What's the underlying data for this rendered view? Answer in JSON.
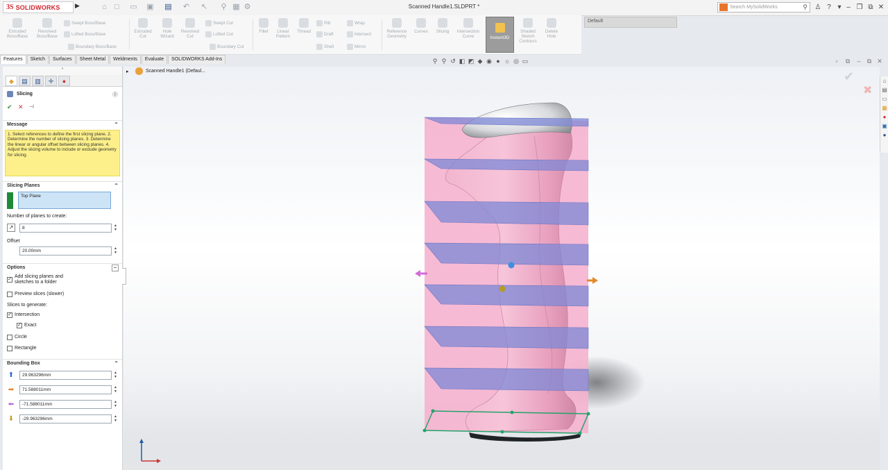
{
  "app": {
    "logo_mark": "3S",
    "logo_text": "SOLIDWORKS",
    "document_title": "Scanned Handle1.SLDPRT *",
    "search_placeholder": "Search MySolidWorks",
    "config_value": "Default"
  },
  "quick_access": [
    "home-icon",
    "new-icon",
    "open-icon",
    "save-icon",
    "print-icon",
    "undo-icon",
    "select-icon",
    "rebuild-icon",
    "file-properties-icon",
    "options-icon"
  ],
  "command_manager": {
    "large": [
      {
        "label": "Extruded Boss/Base",
        "icon": "extrude-boss-icon"
      },
      {
        "label": "Revolved Boss/Base",
        "icon": "revolve-boss-icon"
      },
      {
        "label": "Extruded Cut",
        "icon": "extrude-cut-icon"
      },
      {
        "label": "Hole Wizard",
        "icon": "hole-wizard-icon"
      },
      {
        "label": "Revolved Cut",
        "icon": "revolve-cut-icon"
      },
      {
        "label": "Fillet",
        "icon": "fillet-icon"
      },
      {
        "label": "Linear Pattern",
        "icon": "linear-pattern-icon"
      },
      {
        "label": "Thread",
        "icon": "thread-icon"
      },
      {
        "label": "Reference Geometry",
        "icon": "reference-geometry-icon"
      },
      {
        "label": "Curves",
        "icon": "curves-icon"
      },
      {
        "label": "Slicing",
        "icon": "slicing-icon"
      },
      {
        "label": "Intersection Curve",
        "icon": "intersection-curve-icon"
      },
      {
        "label": "Instant3D",
        "icon": "instant3d-icon"
      },
      {
        "label": "Shaded Sketch Contours",
        "icon": "shaded-sketch-icon"
      },
      {
        "label": "Delete Hole",
        "icon": "delete-hole-icon"
      }
    ],
    "small": [
      {
        "label": "Swept Boss/Base"
      },
      {
        "label": "Lofted Boss/Base"
      },
      {
        "label": "Boundary Boss/Base"
      },
      {
        "label": "Swept Cut"
      },
      {
        "label": "Lofted Cut"
      },
      {
        "label": "Boundary Cut"
      },
      {
        "label": "Rib"
      },
      {
        "label": "Draft"
      },
      {
        "label": "Shell"
      },
      {
        "label": "Wrap"
      },
      {
        "label": "Intersect"
      },
      {
        "label": "Mirror"
      }
    ]
  },
  "tabs": [
    "Features",
    "Sketch",
    "Surfaces",
    "Sheet Metal",
    "Weldments",
    "Evaluate",
    "SOLIDWORKS Add-Ins"
  ],
  "active_tab": "Features",
  "tree": {
    "root_label": "Scanned Handle1  (Defaul..."
  },
  "panel": {
    "title": "Slicing",
    "message_header": "Message",
    "message_text": "1. Select references to define the first slicing plane. 2. Determine the number of slicing planes. 3. Determine the linear or angular offset between slicing planes. 4. Adjust the slicing volume to include or exclude geometry for slicing.",
    "slicing_planes_header": "Slicing Planes",
    "selected_plane": "Top Plane",
    "num_planes_label": "Number of planes to create:",
    "num_planes_value": "8",
    "offset_label": "Offset",
    "offset_value": "20.00mm",
    "options_header": "Options",
    "opt_add_slicing": "Add slicing planes and sketches to a folder",
    "opt_preview": "Preview slices (slower)",
    "slices_label": "Slices to generate:",
    "slice_intersection": "Intersection",
    "slice_exact": "Exact",
    "slice_circle": "Circle",
    "slice_rectangle": "Rectangle",
    "bbox_header": "Bounding Box",
    "bbox_values": [
      "29.963296mm",
      "71.588011mm",
      "-71.588011mm",
      "-29.963296mm"
    ]
  },
  "colors": {
    "accent": "#d2242c",
    "slice_plane": "#8891d8",
    "volume": "#f6b3cf",
    "msg_bg": "#fdf08a"
  }
}
